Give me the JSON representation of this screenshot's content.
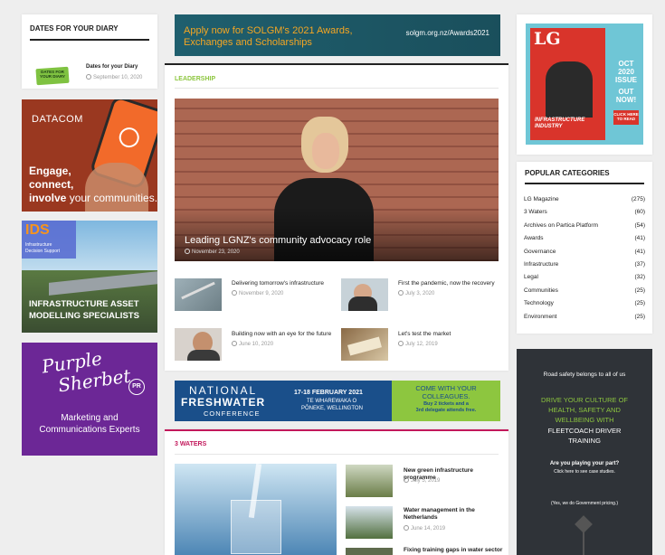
{
  "diary": {
    "heading": "DATES FOR YOUR DIARY",
    "item_title": "Dates for your Diary",
    "item_date": "September 10, 2020",
    "thumb_text": "DATES FOR YOUR DIARY"
  },
  "ad_datacom": {
    "brand": "DATACOM",
    "line1": "Engage,",
    "line2": "connect,",
    "line3_bold": "involve",
    "line3_rest": " your communities."
  },
  "ad_ids": {
    "logo": "IDS",
    "sub1": "Infrastructure",
    "sub2": "Decision Support",
    "tagline1": "INFRASTRUCTURE ASSET",
    "tagline2": "MODELLING SPECIALISTS"
  },
  "ad_purple": {
    "brand1": "Purple",
    "brand2": "Sherbet",
    "badge": "PR",
    "line1": "Marketing and",
    "line2": "Communications Experts"
  },
  "top_banner": {
    "line1": "Apply now for SOLGM's 2021 Awards,",
    "line2": "Exchanges and Scholarships",
    "url": "solgm.org.nz/Awards2021"
  },
  "leadership": {
    "heading": "LEADERSHIP",
    "feature_title": "Leading LGNZ's community advocacy role",
    "feature_date": "November 23, 2020",
    "posts": [
      {
        "title": "Delivering tomorrow's infrastructure",
        "date": "November 9, 2020"
      },
      {
        "title": "First the pandemic, now the recovery",
        "date": "July 3, 2020"
      },
      {
        "title": "Building now with an eye for the future",
        "date": "June 10, 2020"
      },
      {
        "title": "Let's test the market",
        "date": "July 12, 2019"
      }
    ]
  },
  "freshwater": {
    "line1": "NATIONAL",
    "line2": "FRESHWATER",
    "line3": "CONFERENCE",
    "date": "17-18 FEBRUARY 2021",
    "venue1": "TE WHAREWAKA O",
    "venue2": "PŌNEKE, WELLINGTON",
    "cta1": "COME WITH YOUR",
    "cta2": "COLLEAGUES.",
    "cta3": "Buy 2 tickets and a",
    "cta4": "3rd delegate attends free."
  },
  "waters": {
    "heading": "3 WATERS",
    "posts": [
      {
        "title": "New green infrastructure programme",
        "date": "July 5, 2019"
      },
      {
        "title": "Water management in the Netherlands",
        "date": "June 14, 2019"
      },
      {
        "title": "Fixing training gaps in water sector",
        "date": ""
      }
    ]
  },
  "magazine": {
    "logo": "LG",
    "issue1": "OCT",
    "issue2": "2020",
    "issue3": "ISSUE",
    "out1": "OUT",
    "out2": "NOW!",
    "click": "CLICK HERE TO READ",
    "cover_text1": "INFRASTRUCTURE",
    "cover_text2": "INDUSTRY"
  },
  "categories": {
    "heading": "POPULAR CATEGORIES",
    "items": [
      {
        "name": "LG Magazine",
        "count": "(275)"
      },
      {
        "name": "3 Waters",
        "count": "(60)"
      },
      {
        "name": "Archives on Partica Platform",
        "count": "(54)"
      },
      {
        "name": "Awards",
        "count": "(41)"
      },
      {
        "name": "Governance",
        "count": "(41)"
      },
      {
        "name": "Infrastructure",
        "count": "(37)"
      },
      {
        "name": "Legal",
        "count": "(32)"
      },
      {
        "name": "Communities",
        "count": "(25)"
      },
      {
        "name": "Technology",
        "count": "(25)"
      },
      {
        "name": "Environment",
        "count": "(25)"
      }
    ]
  },
  "fleetcoach": {
    "line1": "Road safety belongs to all of us",
    "line2": "DRIVE YOUR CULTURE OF",
    "line3": "HEALTH, SAFETY AND",
    "line4": "WELLBEING WITH",
    "line5": "FLEETCOACH DRIVER",
    "line6": "TRAINING",
    "line7": "Are you playing your part?",
    "line8": "Click here to see case studies.",
    "line9": "(Yes, we do Government pricing.)"
  }
}
